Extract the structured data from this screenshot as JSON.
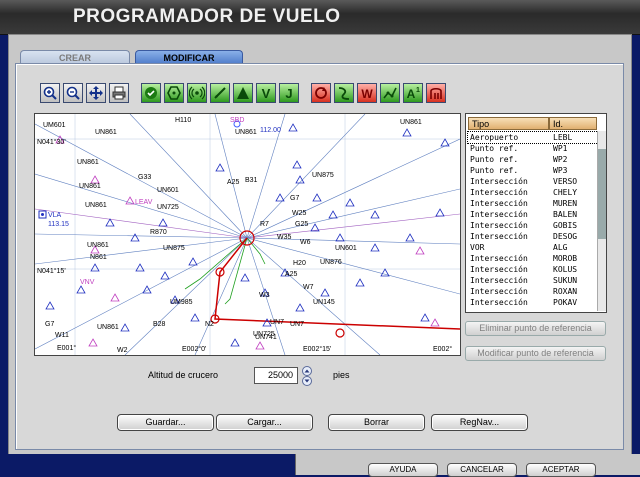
{
  "window": {
    "title": "PROGRAMADOR DE VUELO"
  },
  "tabs": [
    {
      "label": "CREAR",
      "active": false
    },
    {
      "label": "MODIFICAR",
      "active": true
    }
  ],
  "toolbar": [
    {
      "name": "zoom-in-icon"
    },
    {
      "name": "zoom-out-icon"
    },
    {
      "name": "pan-icon"
    },
    {
      "name": "print-icon"
    },
    {
      "name": "check-icon"
    },
    {
      "name": "hexagon-icon"
    },
    {
      "name": "radio-icon"
    },
    {
      "name": "needle-icon"
    },
    {
      "name": "triangle-icon"
    },
    {
      "name": "v-icon"
    },
    {
      "name": "j-icon"
    },
    {
      "name": "circle-arrow-icon"
    },
    {
      "name": "curve-icon"
    },
    {
      "name": "w-icon"
    },
    {
      "name": "route-icon"
    },
    {
      "name": "a1-icon"
    },
    {
      "name": "runway-icon"
    }
  ],
  "map": {
    "labels": [
      "UM601",
      "H110",
      "UN861",
      "N041°30'",
      "UN861",
      "G33",
      "UN861",
      "UN601",
      "UN725",
      "LEAV",
      "VLA",
      "113.15",
      "UN861",
      "UN861",
      "N041°15'",
      "VNV",
      "N861",
      "UM985",
      "G7",
      "W11",
      "UN861",
      "B28",
      "E001°",
      "W2",
      "N2",
      "E002°0'",
      "UN7",
      "UN725",
      "A25",
      "B31",
      "G7",
      "UN875",
      "W25",
      "G25",
      "W35",
      "W6",
      "UN601",
      "A25",
      "H20",
      "UN876",
      "W7",
      "W3",
      "UN145",
      "UN7",
      "UN741",
      "E002°15'",
      "E002°",
      "UN861",
      "SBD",
      "112.00",
      "R7",
      "R870",
      "UN875",
      "UN861"
    ]
  },
  "list": {
    "headers": [
      "Tipo",
      "Id."
    ],
    "rows": [
      [
        "Aeropuerto",
        "LEBL"
      ],
      [
        "Punto ref.",
        "WP1"
      ],
      [
        "Punto ref.",
        "WP2"
      ],
      [
        "Punto ref.",
        "WP3"
      ],
      [
        "Intersección",
        "VERSO"
      ],
      [
        "Intersección",
        "CHELY"
      ],
      [
        "Intersección",
        "MUREN"
      ],
      [
        "Intersección",
        "BALEN"
      ],
      [
        "Intersección",
        "GOBIS"
      ],
      [
        "Intersección",
        "DESOG"
      ],
      [
        "VOR",
        "ALG"
      ],
      [
        "Intersección",
        "MOROB"
      ],
      [
        "Intersección",
        "KOLUS"
      ],
      [
        "Intersección",
        "SUKUN"
      ],
      [
        "Intersección",
        "ROXAN"
      ],
      [
        "Intersección",
        "POKAV"
      ]
    ]
  },
  "side_buttons": {
    "remove": "Eliminar punto de referencia",
    "modify": "Modificar punto de referencia"
  },
  "altitude": {
    "label": "Altitud de crucero",
    "value": "25000",
    "unit": "pies"
  },
  "actions": {
    "save": "Guardar...",
    "load": "Cargar...",
    "delete": "Borrar",
    "regnav": "RegNav..."
  },
  "footer": {
    "help": "AYUDA",
    "cancel": "CANCELAR",
    "accept": "ACEPTAR"
  },
  "colors": {
    "route": "#cc0000",
    "airway_low": "#000080",
    "airway_high": "#800080"
  }
}
